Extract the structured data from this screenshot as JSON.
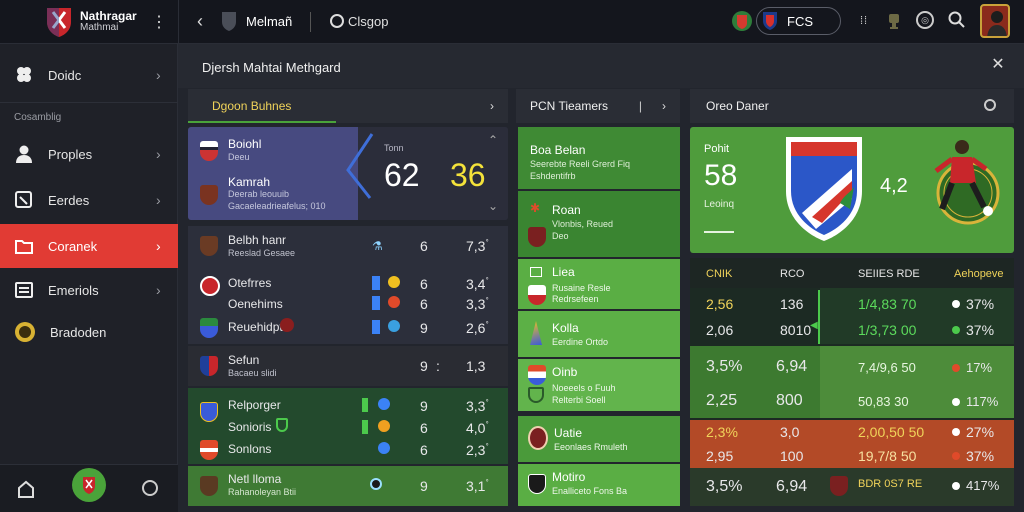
{
  "app": {
    "logo_title": "Nathragar",
    "logo_subtitle": "Mathmai",
    "section_title": "Melmañ",
    "tab_label": "Clsgop",
    "profile_label": "FCS"
  },
  "sidebar": {
    "items": [
      {
        "label": "Doidc",
        "icon": "clover-icon"
      },
      {
        "label": "Proples",
        "icon": "user-icon"
      },
      {
        "label": "Eerdes",
        "icon": "note-icon"
      },
      {
        "label": "Coranek",
        "icon": "folder-icon"
      },
      {
        "label": "Emeriols",
        "icon": "list-icon"
      },
      {
        "label": "Bradoden",
        "icon": "coin-icon"
      }
    ],
    "group_label": "Cosamblig"
  },
  "panel": {
    "title": "Djersh Mahtai Methgard",
    "col1_tab": "Dgoon Buhnes",
    "col2_tab": "PCN Tieamers",
    "col3_tab": "Oreo Daner"
  },
  "match_card": {
    "team1": "Boiohl",
    "team1_sub": "Deeu",
    "team2": "Kamrah",
    "team2_sub": "Deerab leouuib",
    "team2_detail": "Gacaeleadrieafelus; 010",
    "score_label": "Tonn",
    "score_a": "62",
    "score_b": "36"
  },
  "matches": [
    {
      "name": "Belbh hanr",
      "sub": "Reeslad Gesaee",
      "a": "6",
      "b": "7,3",
      "sep": "ﾟ"
    },
    {
      "name": "Otefrres",
      "sub": "",
      "a": "6",
      "b": "3,4",
      "sep": "ﾟ"
    },
    {
      "name": "Oenehims",
      "sub": "",
      "a": "6",
      "b": "3,3",
      "sep": "ﾟ"
    },
    {
      "name": "Reuehidpt",
      "sub": "",
      "a": "9",
      "b": "2,6",
      "sep": "ﾟ"
    },
    {
      "name": "Sefun",
      "sub": "Bacaeu slidi",
      "a": "9",
      "b": "1,3",
      "sep": ":"
    },
    {
      "name": "Relporger",
      "sub": "",
      "a": "9",
      "b": "3,3",
      "sep": "ﾟ"
    },
    {
      "name": "Sonioris",
      "sub": "",
      "a": "6",
      "b": "4,0",
      "sep": "ﾟ"
    },
    {
      "name": "Sonlons",
      "sub": "",
      "a": "6",
      "b": "2,3",
      "sep": "ﾟ"
    },
    {
      "name": "Netl lloma",
      "sub": "Rahanoleyan Btii",
      "a": "9",
      "b": "3,1",
      "sep": "ﾟ"
    }
  ],
  "teams": [
    {
      "name": "Boa Belan",
      "l1": "Seerebte Reeli Grerd Fiq",
      "l2": "Eshdentifrb"
    },
    {
      "name": "Roan",
      "l1": "Vlonbis, Reued",
      "l2": "Deo"
    },
    {
      "name": "Liea",
      "l1": "Rusaine Resle",
      "l2": "Redrsefeen"
    },
    {
      "name": "Kolla",
      "l1": "Eerdine Ortdo",
      "l2": ""
    },
    {
      "name": "Oinb",
      "l1": "Noeeels o Fuuh",
      "l2": "Relterbi Soell"
    },
    {
      "name": "Uatie",
      "l1": "Eeonlaes Rmuleth",
      "l2": ""
    },
    {
      "name": "Motiro",
      "l1": "Enalliceto Fons Ba",
      "l2": ""
    }
  ],
  "feature": {
    "label": "Pohit",
    "value": "58",
    "sub": "Leoinq",
    "score": "4,2"
  },
  "stats": {
    "headers": [
      "CNIK",
      "RCO",
      "SEIIES RDE",
      "Aehopeve"
    ],
    "rows": [
      {
        "a": "2,56",
        "b": "136",
        "c": "1/4,83 70",
        "d": "37%"
      },
      {
        "a": "2,06",
        "b": "8010",
        "c": "1/3,73 00",
        "d": "37%"
      },
      {
        "a": "3,5%",
        "b": "6,94",
        "c": "7,4/9,6 50",
        "d": "17%"
      },
      {
        "a": "2,25",
        "b": "800",
        "c": "50,83 30",
        "d": "117%"
      },
      {
        "a": "2,3%",
        "b": "3,0",
        "c": "2,00,50 50",
        "d": "27%"
      },
      {
        "a": "2,95",
        "b": "100",
        "c": "19,7/8 50",
        "d": "37%"
      },
      {
        "a": "3,5%",
        "b": "6,94",
        "c": "BDR 0S7 RE",
        "d": "417%"
      }
    ]
  }
}
